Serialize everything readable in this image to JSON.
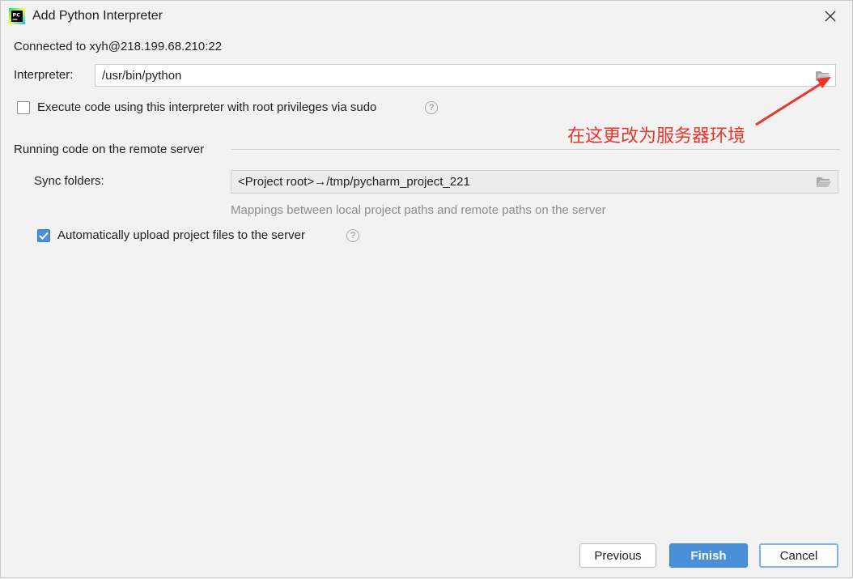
{
  "window": {
    "title": "Add Python Interpreter",
    "app_icon": "pycharm-icon",
    "close_icon": "close-icon"
  },
  "connection": {
    "text": "Connected to xyh@218.199.68.210:22"
  },
  "interpreter": {
    "label": "Interpreter:",
    "value": "/usr/bin/python",
    "browse_icon": "folder-icon"
  },
  "sudo": {
    "label": "Execute code using this interpreter with root privileges via sudo",
    "checked": false,
    "help_icon": "help-icon"
  },
  "annotation": {
    "text": "在这更改为服务器环境",
    "color": "#e8372b"
  },
  "remote": {
    "section_title": "Running code on the remote server",
    "sync_label": "Sync folders:",
    "sync_value": "<Project root>→/tmp/pycharm_project_221",
    "sync_hint": "Mappings between local project paths and remote paths on the server",
    "upload_label": "Automatically upload project files to the server",
    "upload_checked": true
  },
  "buttons": {
    "previous": "Previous",
    "finish": "Finish",
    "cancel": "Cancel"
  },
  "colors": {
    "accent": "#4a8fd9",
    "background": "#f2f2f2"
  }
}
